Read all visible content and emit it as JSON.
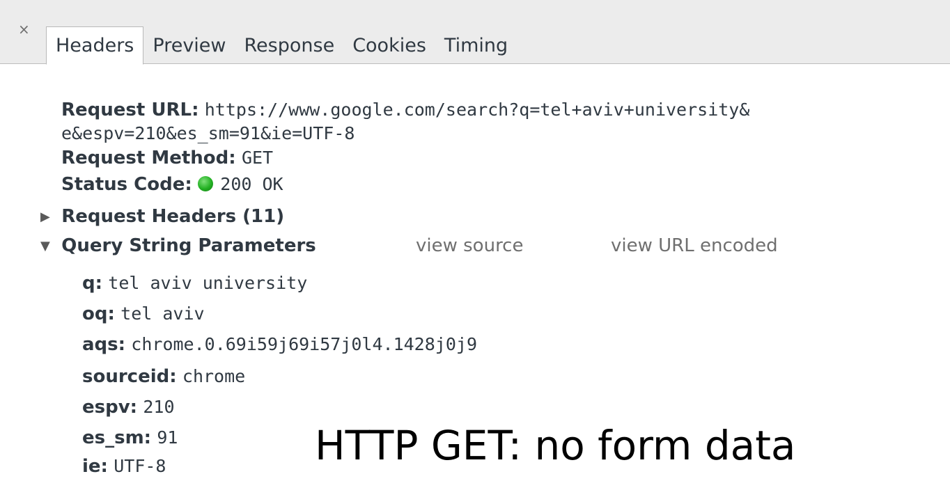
{
  "tabbar": {
    "close_icon": "×",
    "tabs": [
      {
        "label": "Headers",
        "selected": true
      },
      {
        "label": "Preview",
        "selected": false
      },
      {
        "label": "Response",
        "selected": false
      },
      {
        "label": "Cookies",
        "selected": false
      },
      {
        "label": "Timing",
        "selected": false
      }
    ]
  },
  "general": {
    "request_url_key": "Request URL:",
    "request_url_value": "https://www.google.com/search?q=tel+aviv+university&",
    "request_url_value_cont": "e&espv=210&es_sm=91&ie=UTF-8",
    "request_method_key": "Request Method:",
    "request_method_value": "GET",
    "status_code_key": "Status Code:",
    "status_code_value": "200 OK",
    "status_color": "#22b022"
  },
  "request_headers": {
    "disclosure": "▶",
    "title": "Request Headers (11)"
  },
  "query_string": {
    "disclosure": "▼",
    "title": "Query String Parameters",
    "view_source": "view source",
    "view_url_encoded": "view URL encoded",
    "params": [
      {
        "key": "q:",
        "value": "tel aviv university"
      },
      {
        "key": "oq:",
        "value": "tel aviv"
      },
      {
        "key": "aqs:",
        "value": "chrome.0.69i59j69i57j0l4.1428j0j9"
      },
      {
        "key": "sourceid:",
        "value": "chrome"
      },
      {
        "key": "espv:",
        "value": "210"
      },
      {
        "key": "es_sm:",
        "value": "91"
      },
      {
        "key": "ie:",
        "value": "UTF-8"
      }
    ]
  },
  "caption": "HTTP GET: no form data"
}
